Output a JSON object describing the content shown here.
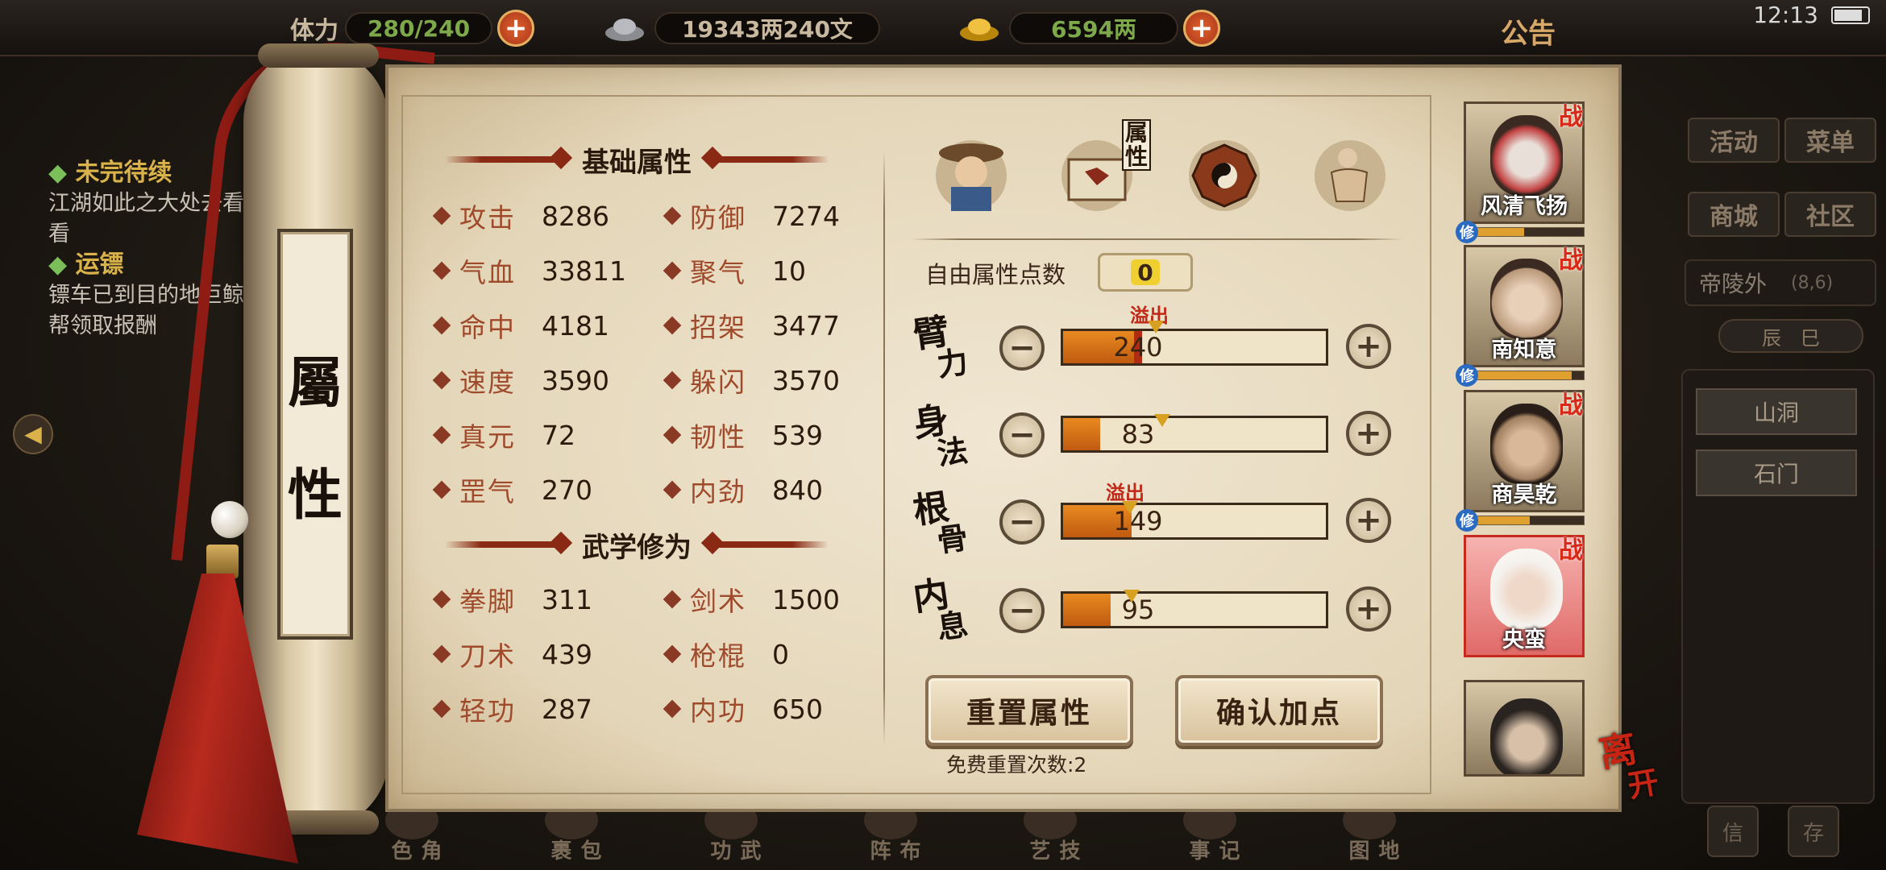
{
  "topbar": {
    "stamina_label": "体力",
    "stamina": "280/240",
    "silver": "19343两240文",
    "gold": "6594两",
    "notice": "公告",
    "time": "12:13"
  },
  "quests": [
    {
      "title": "未完待续",
      "desc": "江湖如此之大处去看看"
    },
    {
      "title": "运镖",
      "desc": "镖车已到目的地巨鲸帮领取报酬"
    }
  ],
  "scroll_title": [
    "屬",
    "性"
  ],
  "basic_section": "基础属性",
  "martial_section": "武学修为",
  "basic_stats": [
    {
      "label": "攻击",
      "value": "8286"
    },
    {
      "label": "防御",
      "value": "7274"
    },
    {
      "label": "气血",
      "value": "33811"
    },
    {
      "label": "聚气",
      "value": "10"
    },
    {
      "label": "命中",
      "value": "4181"
    },
    {
      "label": "招架",
      "value": "3477"
    },
    {
      "label": "速度",
      "value": "3590"
    },
    {
      "label": "躲闪",
      "value": "3570"
    },
    {
      "label": "真元",
      "value": "72"
    },
    {
      "label": "韧性",
      "value": "539"
    },
    {
      "label": "罡气",
      "value": "270"
    },
    {
      "label": "内劲",
      "value": "840"
    }
  ],
  "martial_stats": [
    {
      "label": "拳脚",
      "value": "311"
    },
    {
      "label": "剑术",
      "value": "1500"
    },
    {
      "label": "刀术",
      "value": "439"
    },
    {
      "label": "枪棍",
      "value": "0"
    },
    {
      "label": "轻功",
      "value": "287"
    },
    {
      "label": "内功",
      "value": "650"
    }
  ],
  "tabs": {
    "active_label": "属性",
    "icons": [
      "character-icon",
      "scroll-book-icon",
      "bagua-icon",
      "muscle-icon"
    ]
  },
  "free_points_label": "自由属性点数",
  "free_points": "0",
  "attributes": [
    {
      "name": "臂力",
      "chars": [
        "臂",
        "力"
      ],
      "value": "240",
      "fill": 0.27,
      "overflow": true,
      "overflow_label": "溢出"
    },
    {
      "name": "身法",
      "chars": [
        "身",
        "法"
      ],
      "value": "83",
      "fill": 0.14,
      "overflow": false
    },
    {
      "name": "根骨",
      "chars": [
        "根",
        "骨"
      ],
      "value": "149",
      "fill": 0.26,
      "overflow": true,
      "overflow_label": "溢出"
    },
    {
      "name": "内息",
      "chars": [
        "内",
        "息"
      ],
      "value": "95",
      "fill": 0.18,
      "overflow": false
    }
  ],
  "buttons": {
    "reset": "重置属性",
    "confirm": "确认加点"
  },
  "free_reset": "免费重置次数:2",
  "party": [
    {
      "name": "风清飞扬",
      "tag": "战",
      "xiu": "修",
      "progress": 0.5
    },
    {
      "name": "南知意",
      "tag": "战",
      "xiu": "修",
      "progress": 0.9
    },
    {
      "name": "商昊乾",
      "tag": "战",
      "xiu": "修",
      "progress": 0.55
    },
    {
      "name": "央蛮",
      "tag": "战"
    }
  ],
  "leave": [
    "离",
    "开"
  ],
  "right_menu": {
    "buttons": [
      "活动",
      "菜单",
      "商城",
      "社区"
    ],
    "location": "帝陵外",
    "coord": "(8,6)",
    "time": [
      "辰",
      "巳"
    ],
    "places": [
      "山洞",
      "石门"
    ],
    "bottom": [
      "信",
      "存"
    ]
  },
  "bottom_nav": [
    "角色",
    "包裹",
    "武功",
    "布阵",
    "技艺",
    "记事",
    "地图"
  ],
  "colors": {
    "accent_red": "#a04a2c",
    "bar_fill": "#e88a20",
    "overflow": "#c02818"
  }
}
